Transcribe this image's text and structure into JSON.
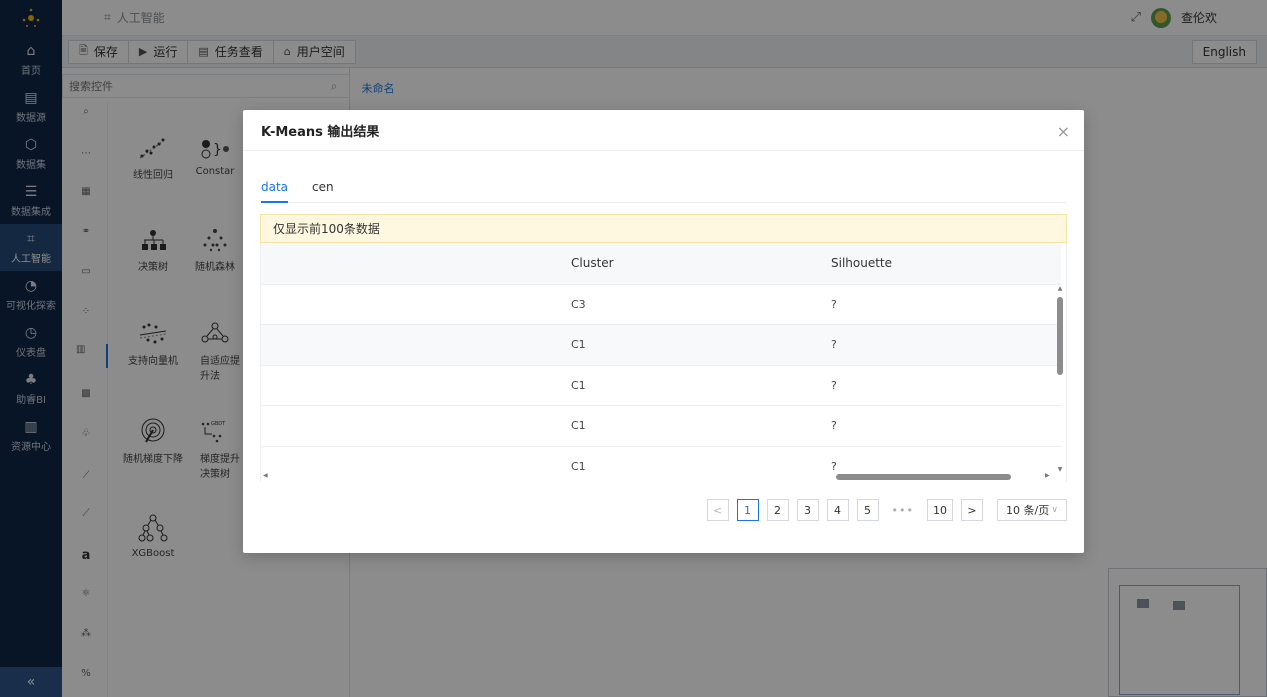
{
  "header": {
    "breadcrumb": "人工智能",
    "user_name": "查伦欢"
  },
  "nav": {
    "items": [
      {
        "label": "首页",
        "icon": "home-icon"
      },
      {
        "label": "数据源",
        "icon": "database-icon"
      },
      {
        "label": "数据集",
        "icon": "cube-icon"
      },
      {
        "label": "数据集成",
        "icon": "server-icon"
      },
      {
        "label": "人工智能",
        "icon": "ai-icon"
      },
      {
        "label": "可视化探索",
        "icon": "pie-chart-icon"
      },
      {
        "label": "仪表盘",
        "icon": "dashboard-icon"
      },
      {
        "label": "助睿BI",
        "icon": "org-chart-icon"
      },
      {
        "label": "资源中心",
        "icon": "book-icon"
      }
    ],
    "active": "人工智能",
    "collapse": "«"
  },
  "toolbar": {
    "save": "保存",
    "run": "运行",
    "tasks": "任务查看",
    "user_space": "用户空间",
    "language": "English"
  },
  "panel": {
    "search_placeholder": "搜索控件",
    "widgets": [
      {
        "label": "线性回归"
      },
      {
        "label": "Constar"
      },
      {
        "label": "决策树"
      },
      {
        "label": "随机森林"
      },
      {
        "label": "支持向量机"
      },
      {
        "label": "自适应提升法"
      },
      {
        "label": "随机梯度下降"
      },
      {
        "label": "梯度提升决策树"
      },
      {
        "label": "XGBoost"
      }
    ],
    "category_letter": "a"
  },
  "canvas": {
    "tab": "未命名"
  },
  "modal": {
    "title": "K-Means 输出结果",
    "close": "×",
    "tabs": [
      {
        "label": "data"
      },
      {
        "label": "cen"
      }
    ],
    "notice": "仅显示前100条数据",
    "table": {
      "columns": [
        "",
        "Cluster",
        "Silhouette"
      ],
      "rows": [
        [
          "",
          "C3",
          "?"
        ],
        [
          "",
          "C1",
          "?"
        ],
        [
          "",
          "C1",
          "?"
        ],
        [
          "",
          "C1",
          "?"
        ],
        [
          "",
          "C1",
          "?"
        ]
      ]
    },
    "pagination": {
      "prev": "<",
      "pages": [
        "1",
        "2",
        "3",
        "4",
        "5"
      ],
      "ellipsis": "•••",
      "last": "10",
      "next": ">",
      "page_size": "10 条/页",
      "current": "1"
    }
  }
}
